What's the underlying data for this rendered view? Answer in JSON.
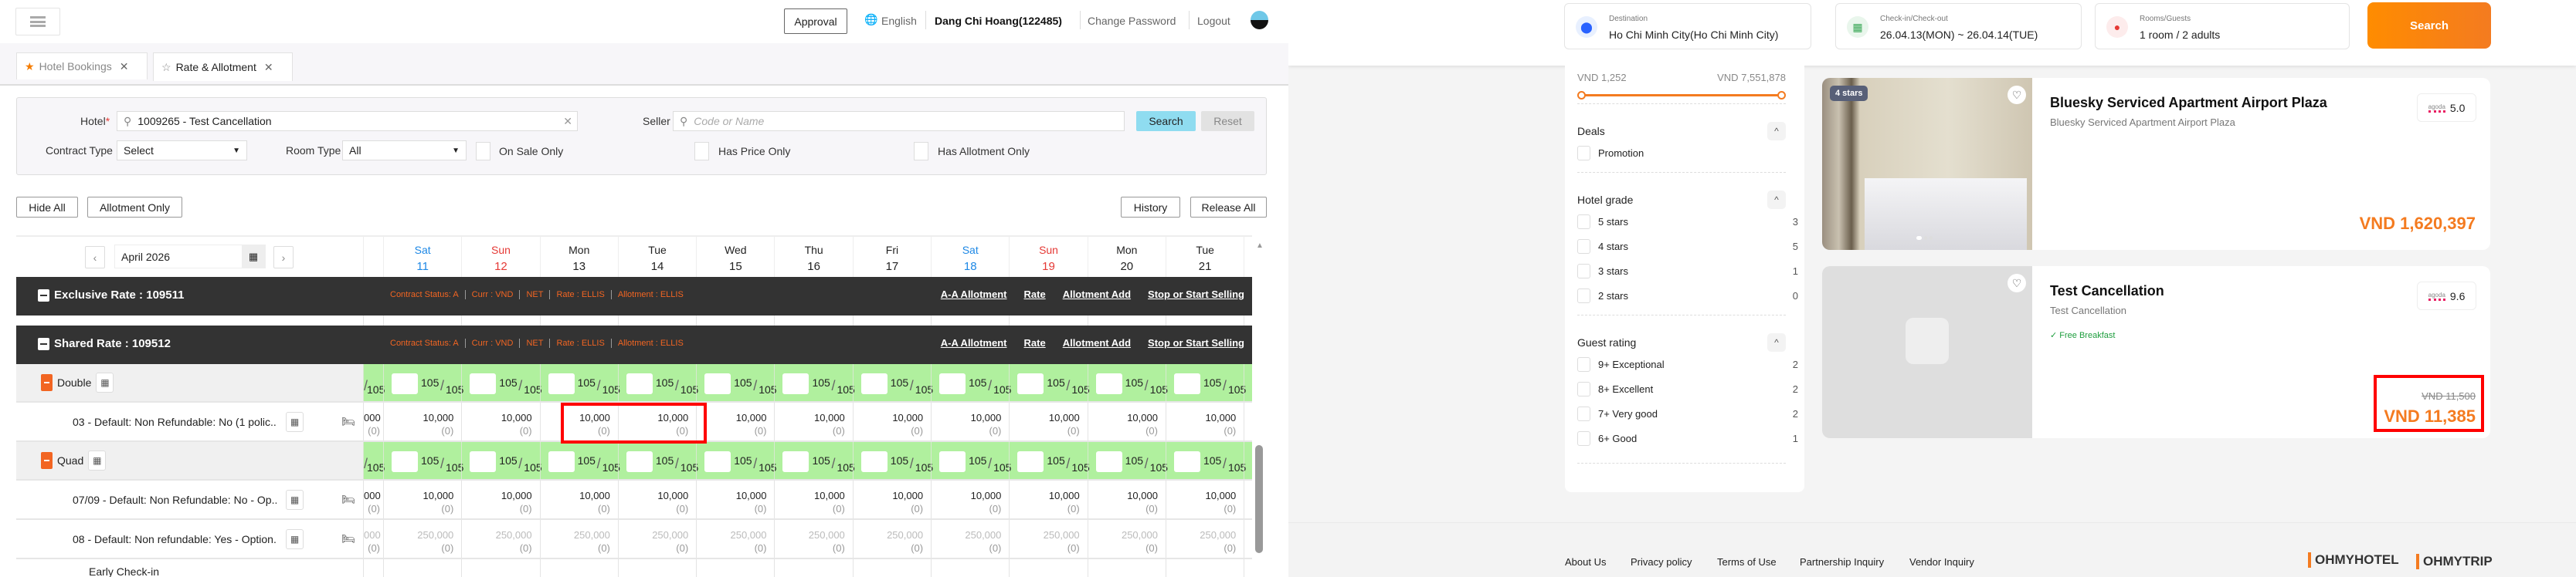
{
  "admin": {
    "header": {
      "approval": "Approval",
      "language": "English",
      "user": "Dang Chi Hoang(122485)",
      "change_password": "Change Password",
      "logout": "Logout"
    },
    "tabs": [
      {
        "label": "Hotel Bookings"
      },
      {
        "label": "Rate & Allotment"
      }
    ],
    "filter": {
      "hotel_label": "Hotel",
      "hotel_required": "*",
      "hotel_value": "1009265 - Test Cancellation",
      "seller_label": "Seller",
      "seller_placeholder": "Code or Name",
      "search": "Search",
      "reset": "Reset",
      "contract_type_label": "Contract Type",
      "contract_type_value": "Select",
      "room_type_label": "Room Type",
      "room_type_value": "All",
      "on_sale_only": "On Sale Only",
      "has_price_only": "Has Price Only",
      "has_allotment_only": "Has Allotment Only"
    },
    "toolbar": {
      "hide_all": "Hide All",
      "allotment_only": "Allotment Only",
      "history": "History",
      "release_all": "Release All"
    },
    "calendar": {
      "month": "April 2026",
      "days": [
        {
          "dow": "Sat",
          "day": "11",
          "color": "#1e88e5"
        },
        {
          "dow": "Sun",
          "day": "12",
          "color": "#e53935"
        },
        {
          "dow": "Mon",
          "day": "13",
          "color": "#222"
        },
        {
          "dow": "Tue",
          "day": "14",
          "color": "#222"
        },
        {
          "dow": "Wed",
          "day": "15",
          "color": "#222"
        },
        {
          "dow": "Thu",
          "day": "16",
          "color": "#222"
        },
        {
          "dow": "Fri",
          "day": "17",
          "color": "#222"
        },
        {
          "dow": "Sat",
          "day": "18",
          "color": "#1e88e5"
        },
        {
          "dow": "Sun",
          "day": "19",
          "color": "#e53935"
        },
        {
          "dow": "Mon",
          "day": "20",
          "color": "#222"
        },
        {
          "dow": "Tue",
          "day": "21",
          "color": "#222"
        }
      ]
    },
    "rates": [
      {
        "title": "Exclusive Rate : 109511",
        "status": [
          "Contract Status: A",
          "Curr : VND",
          "NET",
          "Rate : ELLIS",
          "Allotment : ELLIS"
        ],
        "actions": [
          "A-A Allotment",
          "Rate",
          "Allotment Add",
          "Stop or Start Selling"
        ]
      },
      {
        "title": "Shared Rate : 109512",
        "status": [
          "Contract Status: A",
          "Curr : VND",
          "NET",
          "Rate : ELLIS",
          "Allotment : ELLIS"
        ],
        "actions": [
          "A-A Allotment",
          "Rate",
          "Allotment Add",
          "Stop or Start Selling"
        ]
      }
    ],
    "rooms": [
      {
        "name": "Double",
        "allot_partial": "105",
        "allot": [
          "105",
          "105",
          "105",
          "105",
          "105",
          "105",
          "105",
          "105",
          "105",
          "105",
          "105"
        ],
        "allot_total": "105",
        "plans": [
          {
            "label": "03 - Default: Non Refundable: No (1 polic...",
            "partial": "000",
            "price": "10,000",
            "count": "(0)",
            "muted": false
          }
        ]
      },
      {
        "name": "Quad",
        "allot_partial": "105",
        "allot": [
          "105",
          "105",
          "105",
          "105",
          "105",
          "105",
          "105",
          "105",
          "105",
          "105",
          "105"
        ],
        "allot_total": "105",
        "plans": [
          {
            "label": "07/09 - Default: Non Refundable: No - Op...",
            "partial": "000",
            "price": "10,000",
            "count": "(0)",
            "muted": false
          },
          {
            "label": "08 - Default: Non refundable: Yes - Option...",
            "partial": "000",
            "price": "250,000",
            "count": "(0)",
            "muted": true
          }
        ]
      }
    ],
    "next_room": "Early Check-in"
  },
  "consumer": {
    "search": {
      "destination_label": "Destination",
      "destination": "Ho Chi Minh City(Ho Chi Minh City)",
      "dates_label": "Check-in/Check-out",
      "dates": "26.04.13(MON) ~ 26.04.14(TUE)",
      "guests_label": "Rooms/Guests",
      "guests": "1 room / 2 adults",
      "button": "Search"
    },
    "filters": {
      "price_min": "VND 1,252",
      "price_max": "VND 7,551,878",
      "deals": {
        "title": "Deals",
        "items": [
          {
            "label": "Promotion"
          }
        ]
      },
      "grade": {
        "title": "Hotel grade",
        "items": [
          {
            "label": "5 stars",
            "count": "3"
          },
          {
            "label": "4 stars",
            "count": "5"
          },
          {
            "label": "3 stars",
            "count": "1"
          },
          {
            "label": "2 stars",
            "count": "0"
          }
        ]
      },
      "rating": {
        "title": "Guest rating",
        "items": [
          {
            "label": "9+ Exceptional",
            "count": "2"
          },
          {
            "label": "8+ Excellent",
            "count": "2"
          },
          {
            "label": "7+ Very good",
            "count": "2"
          },
          {
            "label": "6+ Good",
            "count": "1"
          }
        ]
      }
    },
    "hotels": [
      {
        "badge": "4 stars",
        "name": "Bluesky Serviced Apartment Airport Plaza",
        "subtitle": "Bluesky Serviced Apartment Airport Plaza",
        "source": "agoda",
        "score": "5.0",
        "price": "VND 1,620,397"
      },
      {
        "name": "Test Cancellation",
        "subtitle": "Test Cancellation",
        "perk": "Free Breakfast",
        "source": "agoda",
        "score": "9.6",
        "old_price": "VND 11,500",
        "price": "VND 11,385"
      }
    ],
    "footer": {
      "links": [
        "About Us",
        "Privacy policy",
        "Terms of Use",
        "Partnership Inquiry",
        "Vendor Inquiry"
      ],
      "logos": [
        "OHMYHOTEL",
        "OHMYTRIP"
      ]
    }
  },
  "colors": {
    "accent": "#f26522",
    "price": "#f47b20",
    "highlight": "#ff0000",
    "allot_green": "#b0f09e"
  }
}
